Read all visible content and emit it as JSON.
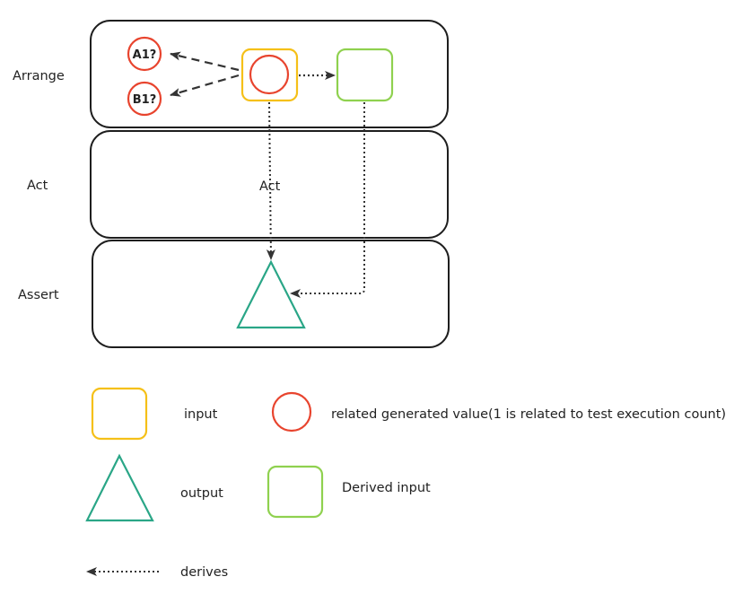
{
  "colors": {
    "stroke_dark": "#1e1e1e",
    "arrow": "#333333",
    "input": "#f5c018",
    "generated": "#e8442e",
    "output": "#2aa687",
    "derived": "#8fd14f",
    "text": "#222222"
  },
  "phases": [
    {
      "label": "Arrange"
    },
    {
      "label": "Act",
      "inner_label": "Act"
    },
    {
      "label": "Assert"
    }
  ],
  "arrange": {
    "generated_values": [
      {
        "label": "A1?"
      },
      {
        "label": "B1?"
      }
    ]
  },
  "legend": {
    "items": [
      {
        "shape": "rounded-square-yellow",
        "label": "input"
      },
      {
        "shape": "circle-red",
        "label": "related generated value(1 is related to test execution count)"
      },
      {
        "shape": "triangle-green",
        "label": "output"
      },
      {
        "shape": "rounded-square-green",
        "label": "Derived input"
      },
      {
        "shape": "dotted-arrow",
        "label": "derives"
      }
    ]
  }
}
